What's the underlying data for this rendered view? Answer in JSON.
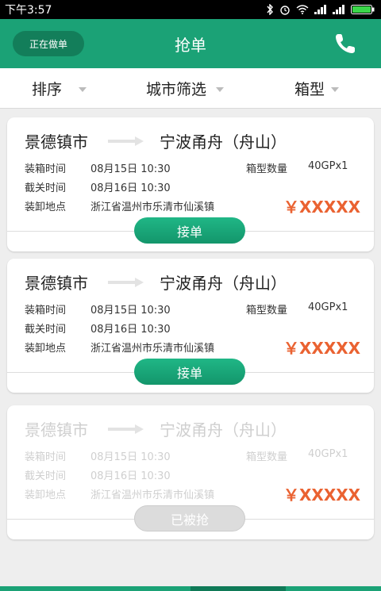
{
  "status": {
    "time": "下午3:57"
  },
  "header": {
    "left_button": "正在做单",
    "title": "抢单"
  },
  "filters": [
    {
      "label": "排序"
    },
    {
      "label": "城市筛选"
    },
    {
      "label": "箱型"
    }
  ],
  "labels": {
    "load_time": "装箱时间",
    "cutoff_time": "截关时间",
    "location": "装卸地点",
    "container_qty": "箱型数量"
  },
  "orders": [
    {
      "from": "景德镇市",
      "to": "宁波甬舟（舟山）",
      "load_time": "08月15日  10:30",
      "cutoff_time": "08月16日  10:30",
      "location": "浙江省温州市乐清市仙溪镇",
      "container_qty": "40GPx1",
      "price": "￥XXXXX",
      "button": "接单",
      "enabled": true
    },
    {
      "from": "景德镇市",
      "to": "宁波甬舟（舟山）",
      "load_time": "08月15日  10:30",
      "cutoff_time": "08月16日  10:30",
      "location": "浙江省温州市乐清市仙溪镇",
      "container_qty": "40GPx1",
      "price": "￥XXXXX",
      "button": "接单",
      "enabled": true
    },
    {
      "from": "景德镇市",
      "to": "宁波甬舟（舟山）",
      "load_time": "08月15日  10:30",
      "cutoff_time": "08月16日  10:30",
      "location": "浙江省温州市乐清市仙溪镇",
      "container_qty": "40GPx1",
      "price": "￥XXXXX",
      "button": "已被抢",
      "enabled": false
    }
  ],
  "colors": {
    "brand": "#1ba276",
    "price": "#ea6231",
    "disabled": "#cfcfcf"
  }
}
